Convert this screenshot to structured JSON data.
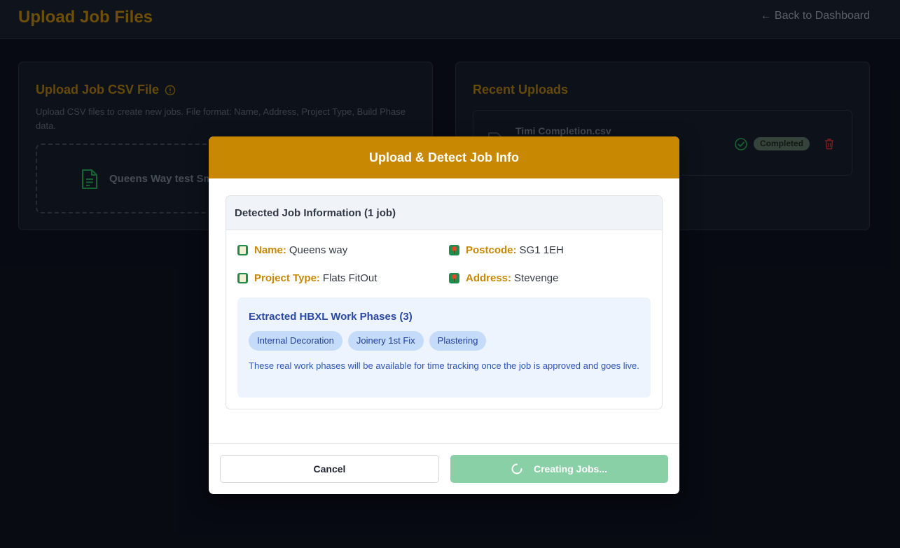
{
  "header": {
    "title": "Upload Job Files",
    "back_link": "← Back to Dashboard"
  },
  "upload_card": {
    "title": "Upload Job CSV File",
    "description": "Upload CSV files to create new jobs. File format: Name, Address, Project Type, Build Phase data.",
    "dropzone_filename": "Queens Way test Sm"
  },
  "recent_uploads": {
    "title": "Recent Uploads",
    "items": [
      {
        "filename": "Timi Completion.csv",
        "status": "Completed"
      }
    ]
  },
  "modal": {
    "title": "Upload & Detect Job Info",
    "detected_title": "Detected Job Information (1 job)",
    "fields": {
      "name_label": "Name:",
      "name_value": "Queens way",
      "postcode_label": "Postcode:",
      "postcode_value": "SG1 1EH",
      "project_type_label": "Project Type:",
      "project_type_value": "Flats FitOut",
      "address_label": "Address:",
      "address_value": "Stevenge"
    },
    "phases": {
      "title": "Extracted HBXL Work Phases (3)",
      "items": [
        "Internal Decoration",
        "Joinery 1st Fix",
        "Plastering"
      ],
      "note": "These real work phases will be available for time tracking once the job is approved and goes live."
    },
    "buttons": {
      "cancel": "Cancel",
      "create": "Creating Jobs..."
    }
  },
  "colors": {
    "accent": "#c88802",
    "success": "#8ad0a6",
    "phase_chip": "#c4dcf9"
  }
}
